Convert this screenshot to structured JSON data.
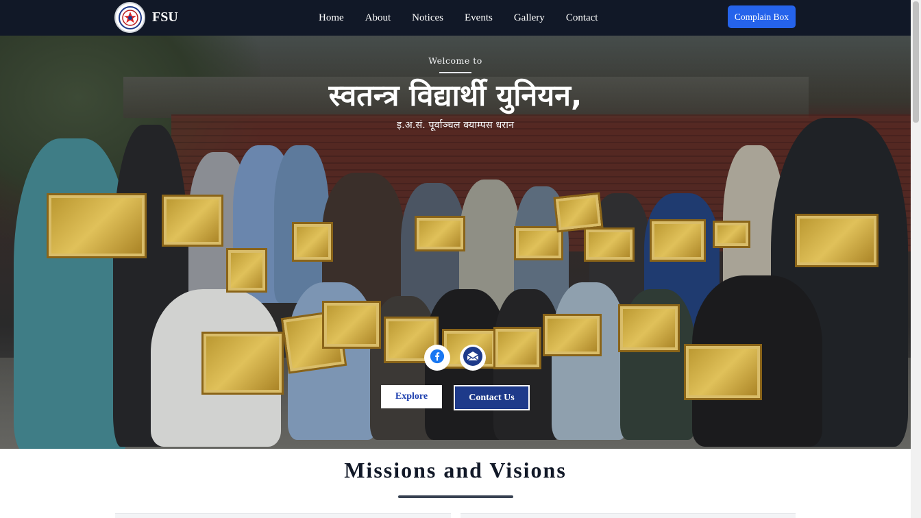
{
  "navbar": {
    "logo_icon": "union-seal-logo",
    "brand": "FSU",
    "links": [
      "Home",
      "About",
      "Notices",
      "Events",
      "Gallery",
      "Contact"
    ],
    "complain_label": "Complain Box",
    "colors": {
      "background": "#111827",
      "button": "#2563eb"
    }
  },
  "hero": {
    "welcome": "Welcome to",
    "title": "स्वतन्त्र विद्यार्थी युनियन,",
    "subtitle": "इ.अ.सं. पूर्वाञ्चल क्याम्पस धरान",
    "social": [
      {
        "icon": "facebook-icon"
      },
      {
        "icon": "email-icon"
      }
    ],
    "explore_label": "Explore",
    "contact_label": "Contact Us",
    "colors": {
      "contact_button": "#1e3a8a",
      "explore_text": "#1e40af"
    }
  },
  "missions": {
    "title": "Missions and Visions"
  }
}
